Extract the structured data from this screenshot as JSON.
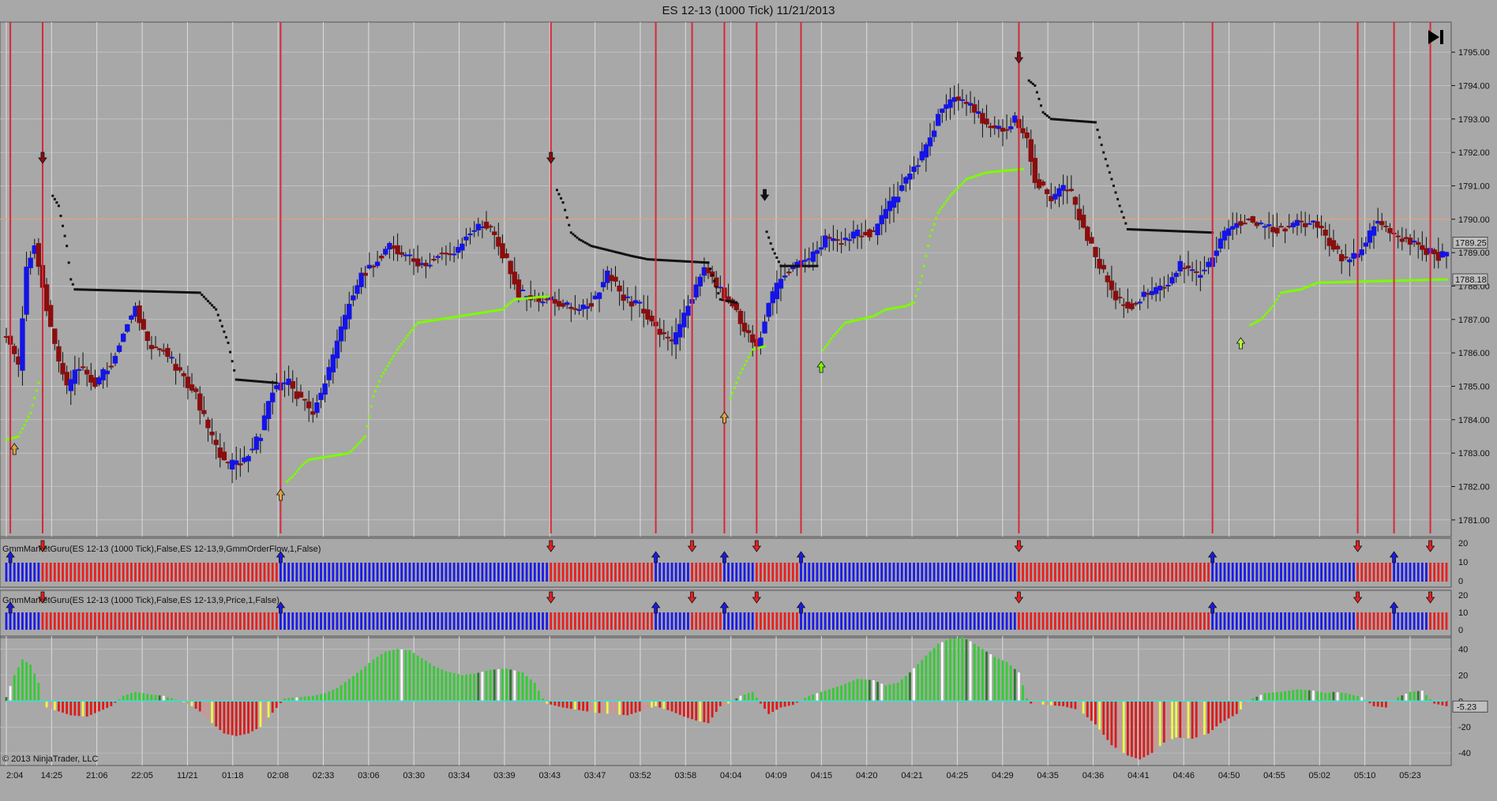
{
  "window": {
    "title": "ES 12-13 (1000 Tick)  11/21/2013",
    "copyright": "© 2013 NinjaTrader, LLC"
  },
  "colors": {
    "background": "#a8a8a8",
    "up_bar": "#1414e6",
    "down_bar": "#8a0e0e",
    "signal_line": "#d62839",
    "stop_upper": "#111111",
    "stop_lower": "#7cfc00",
    "flow_up": "#1a1ae8",
    "flow_down": "#e62020",
    "osc_up": "#33cc33",
    "osc_down": "#e01818",
    "osc_baseline": "#40e0d0",
    "last_price_line": "#e8a070"
  },
  "icons": {
    "skip_to_end": "skip-to-end-icon",
    "buy_signal": "up-arrow-icon",
    "sell_signal": "down-arrow-icon"
  },
  "price_axis": {
    "ticks": [
      "1795.00",
      "1794.00",
      "1793.00",
      "1792.00",
      "1791.00",
      "1790.00",
      "1789.00",
      "1788.00",
      "1787.00",
      "1786.00",
      "1785.00",
      "1784.00",
      "1783.00",
      "1782.00",
      "1781.00"
    ],
    "current_price": "1789.25",
    "stop_price": "1788.18",
    "range": [
      1780.5,
      1795.9
    ]
  },
  "time_axis": {
    "labels": [
      "2:04",
      "14:25",
      "21:06",
      "22:05",
      "11/21",
      "01:18",
      "02:08",
      "02:33",
      "03:06",
      "03:30",
      "03:34",
      "03:39",
      "03:43",
      "03:47",
      "03:52",
      "03:58",
      "04:04",
      "04:09",
      "04:15",
      "04:20",
      "04:21",
      "04:25",
      "04:29",
      "04:35",
      "04:36",
      "04:41",
      "04:46",
      "04:50",
      "04:55",
      "05:02",
      "05:10",
      "05:23"
    ]
  },
  "panels": {
    "order_flow": {
      "name": "GmmMarketGuru(ES 12-13 (1000 Tick),False,ES 12-13,9,GmmOrderFlow,1,False)",
      "axis": [
        "20",
        "10",
        "0"
      ]
    },
    "price_flow": {
      "name": "GmmMarketGuru(ES 12-13 (1000 Tick),False,ES 12-13,9,Price,1,False)",
      "axis": [
        "20",
        "10",
        "0"
      ]
    },
    "oscillator": {
      "axis": [
        "40",
        "20",
        "0",
        "-20",
        "-40"
      ],
      "current_value": "-5.23",
      "range": [
        -46,
        50
      ]
    }
  },
  "chart_data": {
    "type": "candlestick",
    "title": "ES 12-13 (1000 Tick)  11/21/2013",
    "signals": [
      {
        "time": "2:04",
        "dir": "buy"
      },
      {
        "time": "14:25",
        "dir": "sell"
      },
      {
        "time": "01:18",
        "dir": "buy"
      },
      {
        "time": "03:39",
        "dir": "sell"
      },
      {
        "time": "03:47",
        "dir": "buy"
      },
      {
        "time": "03:52",
        "dir": "sell"
      },
      {
        "time": "03:58",
        "dir": "buy"
      },
      {
        "time": "04:04",
        "dir": "sell"
      },
      {
        "time": "04:09",
        "dir": "buy"
      },
      {
        "time": "04:25",
        "dir": "sell"
      },
      {
        "time": "04:46",
        "dir": "buy"
      },
      {
        "time": "05:02",
        "dir": "sell"
      },
      {
        "time": "05:10",
        "dir": "buy"
      },
      {
        "time": "05:23",
        "dir": "sell"
      }
    ],
    "close_path": [
      [
        0,
        1786.6
      ],
      [
        6,
        1785.5
      ],
      [
        10,
        1788.6
      ],
      [
        14,
        1789.2
      ],
      [
        18,
        1788.0
      ],
      [
        24,
        1786.2
      ],
      [
        30,
        1784.9
      ],
      [
        36,
        1785.6
      ],
      [
        44,
        1785.1
      ],
      [
        52,
        1785.7
      ],
      [
        58,
        1786.7
      ],
      [
        64,
        1787.4
      ],
      [
        70,
        1786.3
      ],
      [
        78,
        1786.1
      ],
      [
        86,
        1785.4
      ],
      [
        94,
        1784.7
      ],
      [
        102,
        1783.4
      ],
      [
        110,
        1782.6
      ],
      [
        118,
        1782.8
      ],
      [
        126,
        1783.6
      ],
      [
        132,
        1784.9
      ],
      [
        140,
        1785.1
      ],
      [
        146,
        1784.6
      ],
      [
        152,
        1784.2
      ],
      [
        158,
        1785.1
      ],
      [
        164,
        1786.3
      ],
      [
        170,
        1787.5
      ],
      [
        176,
        1788.3
      ],
      [
        182,
        1788.7
      ],
      [
        190,
        1789.2
      ],
      [
        198,
        1788.9
      ],
      [
        206,
        1788.6
      ],
      [
        214,
        1788.9
      ],
      [
        222,
        1789.0
      ],
      [
        230,
        1789.6
      ],
      [
        236,
        1789.9
      ],
      [
        242,
        1789.5
      ],
      [
        248,
        1788.7
      ],
      [
        254,
        1787.8
      ],
      [
        262,
        1787.6
      ],
      [
        270,
        1787.6
      ],
      [
        278,
        1787.4
      ],
      [
        284,
        1787.3
      ],
      [
        292,
        1787.6
      ],
      [
        298,
        1788.4
      ],
      [
        306,
        1787.6
      ],
      [
        314,
        1787.4
      ],
      [
        322,
        1786.7
      ],
      [
        330,
        1786.2
      ],
      [
        338,
        1787.4
      ],
      [
        346,
        1788.6
      ],
      [
        352,
        1788.0
      ],
      [
        360,
        1787.5
      ],
      [
        366,
        1786.6
      ],
      [
        372,
        1786.2
      ],
      [
        378,
        1787.4
      ],
      [
        384,
        1788.3
      ],
      [
        390,
        1788.6
      ],
      [
        398,
        1788.8
      ],
      [
        406,
        1789.4
      ],
      [
        414,
        1789.3
      ],
      [
        422,
        1789.6
      ],
      [
        430,
        1789.6
      ],
      [
        438,
        1790.4
      ],
      [
        446,
        1791.2
      ],
      [
        454,
        1791.9
      ],
      [
        462,
        1793.1
      ],
      [
        470,
        1793.6
      ],
      [
        478,
        1793.4
      ],
      [
        486,
        1792.8
      ],
      [
        494,
        1792.6
      ],
      [
        500,
        1793.0
      ],
      [
        506,
        1792.3
      ],
      [
        510,
        1791.2
      ],
      [
        518,
        1790.6
      ],
      [
        526,
        1791.0
      ],
      [
        534,
        1789.8
      ],
      [
        542,
        1788.6
      ],
      [
        550,
        1787.6
      ],
      [
        558,
        1787.4
      ],
      [
        566,
        1787.8
      ],
      [
        574,
        1788.0
      ],
      [
        582,
        1788.6
      ],
      [
        590,
        1788.3
      ],
      [
        596,
        1788.6
      ],
      [
        602,
        1789.4
      ],
      [
        608,
        1789.8
      ],
      [
        616,
        1790.1
      ],
      [
        624,
        1789.7
      ],
      [
        632,
        1789.7
      ],
      [
        640,
        1789.9
      ],
      [
        648,
        1789.9
      ],
      [
        656,
        1789.3
      ],
      [
        664,
        1788.7
      ],
      [
        672,
        1789.1
      ],
      [
        680,
        1790.0
      ],
      [
        688,
        1789.5
      ],
      [
        696,
        1789.3
      ],
      [
        702,
        1789.1
      ],
      [
        710,
        1788.9
      ],
      [
        714,
        1789.0
      ]
    ],
    "x_extent": [
      0,
      714
    ],
    "stop_upper": [
      [
        0,
        1786.7
      ],
      [
        20,
        null
      ],
      [
        22,
        1790.8
      ],
      [
        26,
        1790.4
      ],
      [
        30,
        1789.2
      ],
      [
        32,
        1788.2
      ],
      [
        34,
        1787.9
      ],
      [
        96,
        1787.8
      ],
      [
        104,
        1787.3
      ],
      [
        110,
        1786.3
      ],
      [
        114,
        1785.2
      ],
      [
        134,
        1785.1
      ],
      [
        136,
        null
      ],
      [
        270,
        null
      ],
      [
        272,
        1791.0
      ],
      [
        276,
        1790.5
      ],
      [
        280,
        1789.6
      ],
      [
        284,
        1789.4
      ],
      [
        290,
        1789.2
      ],
      [
        310,
        1788.9
      ],
      [
        318,
        1788.8
      ],
      [
        348,
        1788.7
      ],
      [
        354,
        1787.6
      ],
      [
        362,
        1787.5
      ],
      [
        370,
        null
      ],
      [
        376,
        1789.8
      ],
      [
        380,
        1789.1
      ],
      [
        384,
        1788.6
      ],
      [
        402,
        1788.6
      ],
      [
        404,
        null
      ],
      [
        504,
        null
      ],
      [
        506,
        1794.2
      ],
      [
        510,
        1794.0
      ],
      [
        514,
        1793.2
      ],
      [
        518,
        1793.0
      ],
      [
        540,
        1792.9
      ],
      [
        544,
        1792.0
      ],
      [
        548,
        1791.2
      ],
      [
        552,
        1790.4
      ],
      [
        556,
        1789.7
      ],
      [
        598,
        1789.6
      ],
      [
        600,
        null
      ]
    ],
    "stop_lower": [
      [
        0,
        1783.4
      ],
      [
        6,
        1783.5
      ],
      [
        12,
        1784.2
      ],
      [
        16,
        1785.1
      ],
      [
        20,
        null
      ],
      [
        136,
        null
      ],
      [
        138,
        1782.1
      ],
      [
        142,
        1782.3
      ],
      [
        146,
        1782.6
      ],
      [
        150,
        1782.8
      ],
      [
        170,
        1783.0
      ],
      [
        178,
        1783.5
      ],
      [
        182,
        1784.7
      ],
      [
        186,
        1785.3
      ],
      [
        190,
        1785.7
      ],
      [
        194,
        1786.1
      ],
      [
        200,
        1786.6
      ],
      [
        204,
        1786.9
      ],
      [
        246,
        1787.3
      ],
      [
        252,
        1787.6
      ],
      [
        270,
        1787.7
      ],
      [
        272,
        null
      ],
      [
        356,
        null
      ],
      [
        358,
        1784.5
      ],
      [
        364,
        1785.4
      ],
      [
        370,
        1786.1
      ],
      [
        376,
        1786.2
      ],
      [
        378,
        null
      ],
      [
        402,
        null
      ],
      [
        404,
        1786.0
      ],
      [
        410,
        1786.5
      ],
      [
        416,
        1786.9
      ],
      [
        430,
        1787.1
      ],
      [
        436,
        1787.3
      ],
      [
        446,
        1787.4
      ],
      [
        450,
        1787.5
      ],
      [
        454,
        1788.3
      ],
      [
        458,
        1789.5
      ],
      [
        462,
        1790.2
      ],
      [
        468,
        1790.7
      ],
      [
        476,
        1791.2
      ],
      [
        486,
        1791.4
      ],
      [
        504,
        1791.5
      ],
      [
        506,
        null
      ],
      [
        614,
        null
      ],
      [
        616,
        1786.8
      ],
      [
        622,
        1787.0
      ],
      [
        628,
        1787.4
      ],
      [
        632,
        1787.8
      ],
      [
        642,
        1787.9
      ],
      [
        650,
        1788.1
      ],
      [
        714,
        1788.2
      ]
    ],
    "oscillator_path": [
      [
        0,
        3
      ],
      [
        4,
        20
      ],
      [
        8,
        32
      ],
      [
        12,
        28
      ],
      [
        16,
        14
      ],
      [
        18,
        0
      ],
      [
        20,
        -5
      ],
      [
        26,
        -8
      ],
      [
        32,
        -11
      ],
      [
        40,
        -12
      ],
      [
        46,
        -8
      ],
      [
        52,
        -4
      ],
      [
        58,
        4
      ],
      [
        64,
        7
      ],
      [
        72,
        5
      ],
      [
        78,
        4
      ],
      [
        84,
        1
      ],
      [
        90,
        -2
      ],
      [
        96,
        -8
      ],
      [
        102,
        -17
      ],
      [
        108,
        -25
      ],
      [
        114,
        -27
      ],
      [
        120,
        -25
      ],
      [
        126,
        -20
      ],
      [
        132,
        -9
      ],
      [
        138,
        2
      ],
      [
        146,
        3
      ],
      [
        152,
        4
      ],
      [
        158,
        6
      ],
      [
        164,
        10
      ],
      [
        170,
        17
      ],
      [
        176,
        24
      ],
      [
        182,
        32
      ],
      [
        188,
        38
      ],
      [
        194,
        40
      ],
      [
        200,
        39
      ],
      [
        206,
        33
      ],
      [
        212,
        27
      ],
      [
        218,
        23
      ],
      [
        226,
        20
      ],
      [
        232,
        21
      ],
      [
        240,
        24
      ],
      [
        248,
        25
      ],
      [
        256,
        22
      ],
      [
        262,
        14
      ],
      [
        266,
        2
      ],
      [
        268,
        -2
      ],
      [
        276,
        -5
      ],
      [
        284,
        -7
      ],
      [
        292,
        -9
      ],
      [
        300,
        -10
      ],
      [
        308,
        -11
      ],
      [
        316,
        -7
      ],
      [
        322,
        -4
      ],
      [
        330,
        -8
      ],
      [
        336,
        -12
      ],
      [
        342,
        -15
      ],
      [
        348,
        -17
      ],
      [
        354,
        -4
      ],
      [
        358,
        -2
      ],
      [
        364,
        4
      ],
      [
        370,
        7
      ],
      [
        374,
        -2
      ],
      [
        378,
        -10
      ],
      [
        384,
        -5
      ],
      [
        390,
        -3
      ],
      [
        398,
        4
      ],
      [
        406,
        8
      ],
      [
        414,
        12
      ],
      [
        422,
        17
      ],
      [
        430,
        16
      ],
      [
        436,
        12
      ],
      [
        442,
        14
      ],
      [
        448,
        22
      ],
      [
        456,
        35
      ],
      [
        462,
        44
      ],
      [
        468,
        48
      ],
      [
        474,
        49
      ],
      [
        478,
        46
      ],
      [
        484,
        40
      ],
      [
        490,
        34
      ],
      [
        496,
        30
      ],
      [
        502,
        22
      ],
      [
        506,
        2
      ],
      [
        508,
        -2
      ],
      [
        516,
        -3
      ],
      [
        524,
        -4
      ],
      [
        532,
        -7
      ],
      [
        540,
        -18
      ],
      [
        548,
        -34
      ],
      [
        556,
        -42
      ],
      [
        562,
        -45
      ],
      [
        568,
        -40
      ],
      [
        574,
        -32
      ],
      [
        580,
        -28
      ],
      [
        588,
        -29
      ],
      [
        596,
        -25
      ],
      [
        602,
        -17
      ],
      [
        610,
        -10
      ],
      [
        614,
        -3
      ],
      [
        618,
        2
      ],
      [
        624,
        6
      ],
      [
        632,
        7
      ],
      [
        640,
        9
      ],
      [
        648,
        8
      ],
      [
        654,
        6
      ],
      [
        658,
        7
      ],
      [
        664,
        6
      ],
      [
        672,
        3
      ],
      [
        678,
        -4
      ],
      [
        684,
        -5
      ],
      [
        690,
        3
      ],
      [
        696,
        7
      ],
      [
        702,
        8
      ],
      [
        708,
        -2
      ],
      [
        714,
        -4
      ]
    ]
  }
}
